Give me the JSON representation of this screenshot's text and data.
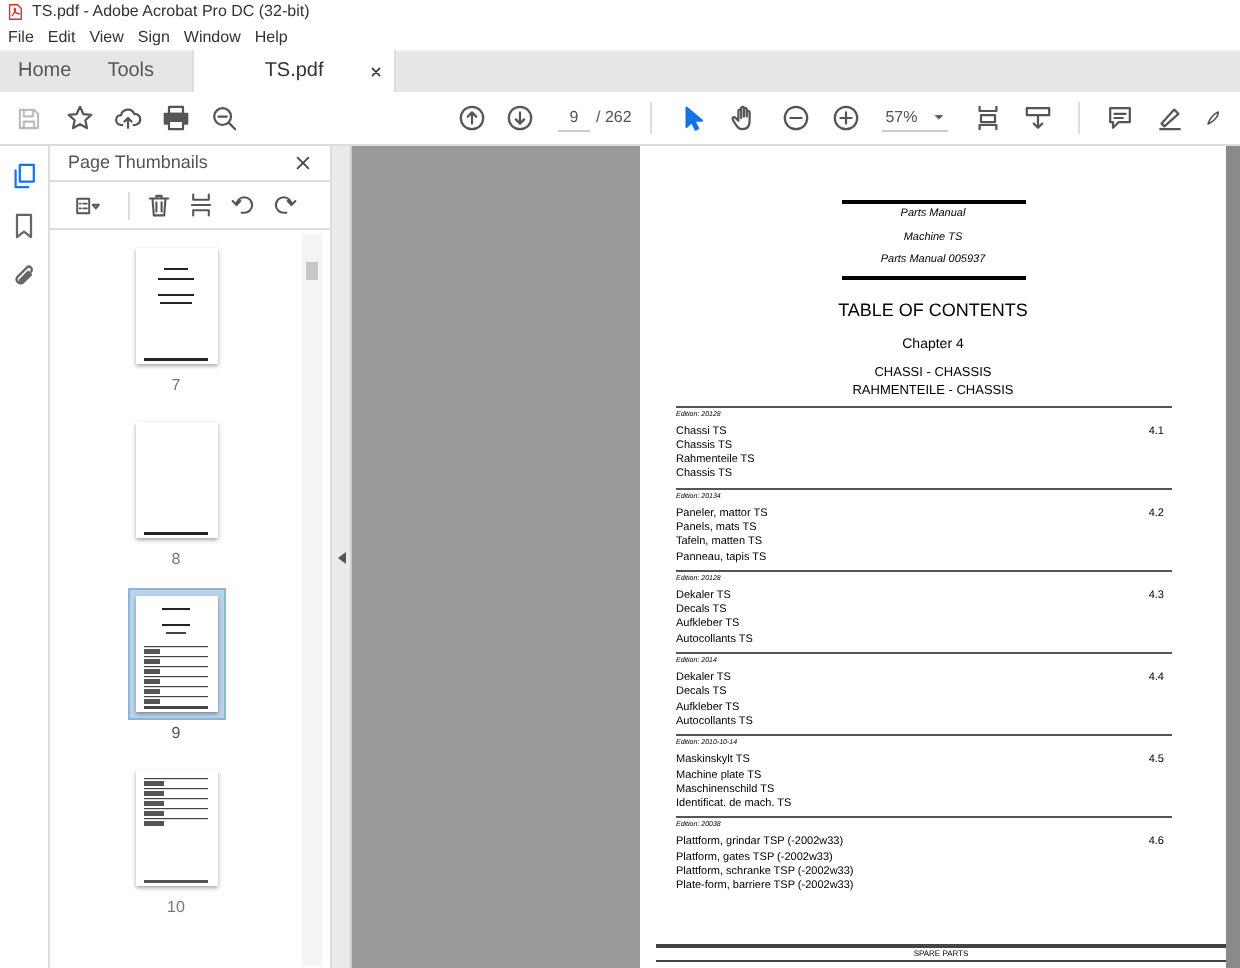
{
  "window": {
    "title": "TS.pdf - Adobe Acrobat Pro DC (32-bit)"
  },
  "menu": [
    "File",
    "Edit",
    "View",
    "Sign",
    "Window",
    "Help"
  ],
  "tabs": [
    {
      "label": "Home",
      "selected": false,
      "kind": "nav"
    },
    {
      "label": "Tools",
      "selected": false,
      "kind": "nav"
    },
    {
      "label": "TS.pdf",
      "selected": true,
      "kind": "document"
    }
  ],
  "toolbar": {
    "page": "9",
    "page_total": "/ 262",
    "zoom": "57%",
    "save_disabled": true,
    "tools": [
      {
        "kind": "select",
        "selected": true
      },
      {
        "kind": "hand",
        "selected": false
      }
    ]
  },
  "sidebar": {
    "title": "Page Thumbnails",
    "panels": [
      {
        "kind": "thumbnails",
        "selected": true
      },
      {
        "kind": "bookmarks",
        "selected": false
      },
      {
        "kind": "attachments",
        "selected": false
      }
    ],
    "thumbnails": [
      {
        "label": "7",
        "selected": false,
        "kind": "cover"
      },
      {
        "label": "8",
        "selected": false,
        "kind": "blank"
      },
      {
        "label": "9",
        "selected": true,
        "kind": "contents"
      },
      {
        "label": "10",
        "selected": false,
        "kind": "list"
      }
    ]
  },
  "page": {
    "header": [
      "Parts Manual",
      "Machine TS",
      "Parts Manual 005937"
    ],
    "heading": "TABLE OF CONTENTS",
    "chapter": "Chapter 4",
    "subtitles": [
      "CHASSI - CHASSIS",
      "RAHMENTEILE - CHASSIS"
    ],
    "sections": [
      {
        "edition": "Edition: 20128",
        "number": "4.1",
        "lines": [
          "Chassi TS",
          "Chassis TS",
          "Rahmenteile TS",
          "Chassis TS"
        ]
      },
      {
        "edition": "Edition: 20134",
        "number": "4.2",
        "lines": [
          "Paneler, mattor TS",
          "Panels, mats TS",
          "Tafeln, matten TS",
          "Panneau, tapis TS"
        ]
      },
      {
        "edition": "Edition: 20128",
        "number": "4.3",
        "lines": [
          "Dekaler TS",
          "Decals TS",
          "Aufkleber TS",
          "Autocollants TS"
        ]
      },
      {
        "edition": "Edition: 2014",
        "number": "4.4",
        "lines": [
          "Dekaler TS",
          "Decals TS",
          "Aufkleber TS",
          "Autocollants TS"
        ]
      },
      {
        "edition": "Edition: 2010-10-14",
        "number": "4.5",
        "lines": [
          "Maskinskylt TS",
          "Machine plate TS",
          "Maschinenschild TS",
          "Identificat. de mach. TS"
        ]
      },
      {
        "edition": "Edition: 20038",
        "number": "4.6",
        "lines": [
          "Plattform, grindar TSP (-2002w33)",
          "Platform, gates TSP (-2002w33)",
          "Plattform, schranke TSP (-2002w33)",
          "Plate-form, barriere TSP (-2002w33)"
        ]
      }
    ],
    "footer": "SPARE PARTS"
  }
}
